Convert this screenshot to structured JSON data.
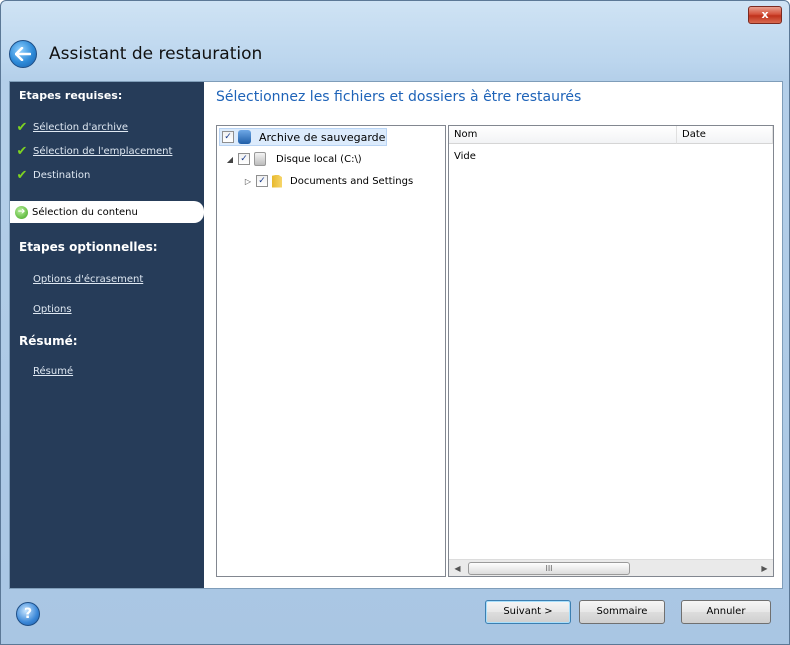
{
  "window": {
    "title": "Assistant de restauration",
    "close_label": "x"
  },
  "sidebar": {
    "required_header": "Etapes requises:",
    "required_steps": [
      {
        "label": "Sélection d'archive",
        "status": "done"
      },
      {
        "label": "Sélection de l'emplacement",
        "status": "done"
      },
      {
        "label": "Destination",
        "status": "done"
      },
      {
        "label": "Sélection du contenu",
        "status": "current"
      }
    ],
    "optional_header": "Etapes optionnelles:",
    "optional_steps": [
      {
        "label": "Options d'écrasement"
      },
      {
        "label": "Options"
      }
    ],
    "summary_header": "Résumé:",
    "summary_steps": [
      {
        "label": "Résumé"
      }
    ]
  },
  "main": {
    "title": "Sélectionnez les fichiers et dossiers à être restaurés",
    "tree": [
      {
        "label": "Archive de sauvegarde",
        "checked": true,
        "icon": "archive-icon",
        "selected": true
      },
      {
        "label": "Disque local (C:\\)",
        "checked": true,
        "icon": "disk-icon",
        "expanded": true
      },
      {
        "label": "Documents and Settings",
        "checked": true,
        "icon": "folder-icon",
        "expanded": false
      }
    ],
    "list": {
      "columns": [
        "Nom",
        "Date"
      ],
      "rows": [
        [
          "Vide",
          ""
        ]
      ],
      "scroll_thumb": "III"
    }
  },
  "footer": {
    "help_label": "?",
    "next_label": "Suivant >",
    "summary_label": "Sommaire",
    "cancel_label": "Annuler"
  }
}
